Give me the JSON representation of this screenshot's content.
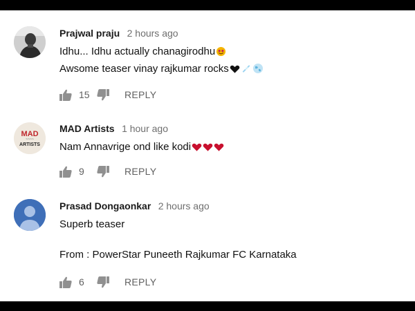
{
  "comments": [
    {
      "author": "Prajwal praju",
      "time": "2 hours ago",
      "lines": [
        "Idhu... Idhu actually chanagirodhu",
        "Awsome teaser vinay rajkumar rocks"
      ],
      "likes": "15",
      "reply": "REPLY"
    },
    {
      "author": "MAD Artists",
      "time": "1 hour ago",
      "avatar_text": [
        "MAD",
        "ARTISTS"
      ],
      "lines": [
        "Nam Annavrige ond like kodi"
      ],
      "likes": "9",
      "reply": "REPLY"
    },
    {
      "author": "Prasad Dongaonkar",
      "time": "2 hours ago",
      "lines": [
        "Superb teaser",
        "From : PowerStar Puneeth Rajkumar FC Karnataka"
      ],
      "likes": "6",
      "reply": "REPLY"
    }
  ],
  "colors": {
    "text": "#111111",
    "muted": "#606060",
    "icon": "#909090",
    "avatar_blue": "#3f6fb8",
    "heart": "#c8102e"
  }
}
